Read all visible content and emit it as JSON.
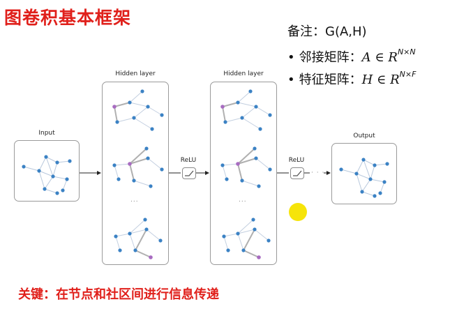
{
  "title": "图卷积基本框架",
  "notes": {
    "line1": "备注：G(A,H)",
    "line2_prefix": "邻接矩阵：",
    "line2_math": "A ∈ R",
    "line2_sup": "N×N",
    "line3_prefix": "特征矩阵：",
    "line3_math": "H ∈ R",
    "line3_sup": "N×F"
  },
  "diagram": {
    "input_label": "Input",
    "hidden1_label": "Hidden layer",
    "hidden2_label": "Hidden layer",
    "output_label": "Output",
    "relu1_label": "ReLU",
    "relu2_label": "ReLU",
    "ellipsis": "...",
    "flow_dots": "· · ·"
  },
  "colors": {
    "title_red": "#e0201b",
    "node_blue": "#3b82c4",
    "node_purple": "#a86cc1",
    "highlight": "#f6e40a"
  },
  "footer": "关键：在节点和社区间进行信息传递"
}
